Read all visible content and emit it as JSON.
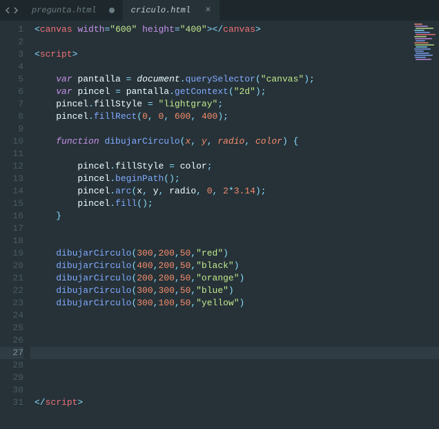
{
  "tabs": [
    {
      "label": "pregunta.html",
      "active": false,
      "dirty": true
    },
    {
      "label": "criculo.html",
      "active": true,
      "dirty": false
    }
  ],
  "current_line": 27,
  "lines": {
    "1": {
      "tag_open": "canvas",
      "attr1": "width",
      "val1": "600",
      "attr2": "height",
      "val2": "400",
      "tag_close": "canvas"
    },
    "3": {
      "tag": "script"
    },
    "5": {
      "kw": "var",
      "var": "pantalla",
      "obj": "document",
      "fn": "querySelector",
      "arg": "\"canvas\""
    },
    "6": {
      "kw": "var",
      "var": "pincel",
      "obj": "pantalla",
      "fn": "getContext",
      "arg": "\"2d\""
    },
    "7": {
      "obj": "pincel",
      "prop": "fillStyle",
      "val": "\"lightgray\""
    },
    "8": {
      "obj": "pincel",
      "fn": "fillRect",
      "a1": "0",
      "a2": "0",
      "a3": "600",
      "a4": "400"
    },
    "10": {
      "kw": "function",
      "name": "dibujarCirculo",
      "p1": "x",
      "p2": "y",
      "p3": "radio",
      "p4": "color"
    },
    "12": {
      "obj": "pincel",
      "prop": "fillStyle",
      "rhs": "color"
    },
    "13": {
      "obj": "pincel",
      "fn": "beginPath"
    },
    "14": {
      "obj": "pincel",
      "fn": "arc",
      "a1": "x",
      "a2": "y",
      "a3": "radio",
      "a4": "0",
      "a5a": "2",
      "a5b": "3.14"
    },
    "15": {
      "obj": "pincel",
      "fn": "fill"
    },
    "19": {
      "fn": "dibujarCirculo",
      "a1": "300",
      "a2": "200",
      "a3": "50",
      "a4": "\"red\""
    },
    "20": {
      "fn": "dibujarCirculo",
      "a1": "400",
      "a2": "200",
      "a3": "50",
      "a4": "\"black\""
    },
    "21": {
      "fn": "dibujarCirculo",
      "a1": "200",
      "a2": "200",
      "a3": "50",
      "a4": "\"orange\""
    },
    "22": {
      "fn": "dibujarCirculo",
      "a1": "300",
      "a2": "300",
      "a3": "50",
      "a4": "\"blue\""
    },
    "23": {
      "fn": "dibujarCirculo",
      "a1": "300",
      "a2": "100",
      "a3": "50",
      "a4": "\"yellow\""
    },
    "31": {
      "tag": "script"
    }
  },
  "minimap_colors": [
    "#f78c6c",
    "#c792ea",
    "#c3e88d",
    "#89ddff",
    "#82aaff",
    "#f07178",
    "#c3e88d",
    "#c792ea",
    "#82aaff",
    "#f78c6c",
    "#c3e88d",
    "#89ddff",
    "#82aaff",
    "#82aaff",
    "#82aaff",
    "#82aaff",
    "#82aaff",
    "#c792ea"
  ]
}
